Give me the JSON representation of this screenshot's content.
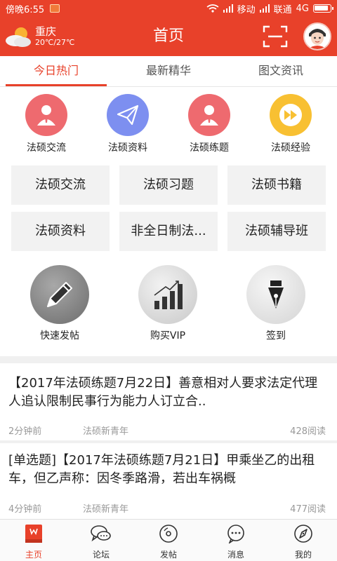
{
  "status_bar": {
    "time": "傍晚6:55",
    "carrier1": "移动",
    "carrier2": "联通",
    "network": "4G"
  },
  "header": {
    "city": "重庆",
    "temperature": "20℃/27℃",
    "title": "首页",
    "accent_color": "#e8412a"
  },
  "tabs": [
    {
      "label": "今日热门",
      "active": true
    },
    {
      "label": "最新精华",
      "active": false
    },
    {
      "label": "图文资讯",
      "active": false
    }
  ],
  "quick_icons": [
    {
      "label": "法硕交流",
      "icon": "person-icon",
      "color": "#ee6a6f"
    },
    {
      "label": "法硕资料",
      "icon": "paper-plane-icon",
      "color": "#7d8ff0"
    },
    {
      "label": "法硕练题",
      "icon": "person-icon",
      "color": "#ee6a6f"
    },
    {
      "label": "法硕经验",
      "icon": "fast-forward-icon",
      "color": "#f8c032"
    }
  ],
  "grid_buttons": [
    "法硕交流",
    "法硕习题",
    "法硕书籍",
    "法硕资料",
    "非全日制法...",
    "法硕辅导班"
  ],
  "actions": [
    {
      "label": "快速发帖",
      "icon": "pencil-icon"
    },
    {
      "label": "购买VIP",
      "icon": "bar-chart-icon"
    },
    {
      "label": "签到",
      "icon": "fountain-pen-icon"
    }
  ],
  "news": [
    {
      "title": "【2017年法硕练题7月22日】善意相对人要求法定代理人追认限制民事行为能力人订立合..",
      "time": "2分钟前",
      "source": "法硕新青年",
      "reads": "428阅读"
    },
    {
      "title": "[单选题]【2017年法硕练题7月21日】甲乘坐乙的出租车，但乙声称：因冬季路滑，若出车祸概",
      "time": "4分钟前",
      "source": "法硕新青年",
      "reads": "477阅读"
    }
  ],
  "bottom_nav": [
    {
      "label": "主页",
      "icon": "book-icon",
      "active": true
    },
    {
      "label": "论坛",
      "icon": "chat-bubbles-icon",
      "active": false
    },
    {
      "label": "发帖",
      "icon": "disc-icon",
      "active": false
    },
    {
      "label": "消息",
      "icon": "message-icon",
      "active": false
    },
    {
      "label": "我的",
      "icon": "compass-icon",
      "active": false
    }
  ]
}
